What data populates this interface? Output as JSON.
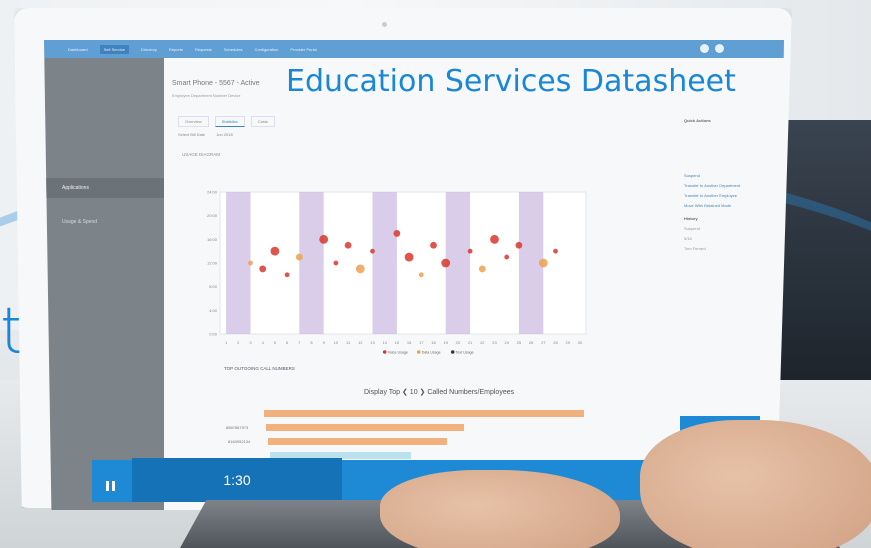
{
  "overlay": {
    "title": "Education Services Datasheet",
    "edge_letter": "t"
  },
  "app": {
    "brand": "",
    "nav": [
      "Dashboard",
      "Self Service",
      "Directory",
      "Reports",
      "Requests",
      "Schedules",
      "Configuration",
      "Provider Portal"
    ],
    "active_nav_index": 1
  },
  "sidebar": {
    "items": [
      "Applications",
      "",
      "Usage & Spend"
    ]
  },
  "page": {
    "title": "Smart Phone - 5567 - Active",
    "subtitle": "Employee  Department  Number  Device",
    "tabs": [
      "Overview",
      "Statistics",
      "Costs"
    ],
    "active_tab_index": 1,
    "selected_billing_label": "Select Bill Date",
    "selected_billing_value": "Jun 2018",
    "display_note": "",
    "usage_section": "USAGE DIAGRAM"
  },
  "right_panel": {
    "header": "Quick Actions",
    "links": [
      "Suspend",
      "Transfer to Another Department",
      "Transfer to Another Employee",
      "Move With Retained Mode"
    ],
    "history_header": "History",
    "history_items": [
      "Suspend",
      "5/18",
      "Tom Ferrard"
    ]
  },
  "chart_data": {
    "type": "scatter",
    "title": "",
    "x_ticks": [
      "1",
      "2",
      "3",
      "4",
      "5",
      "6",
      "7",
      "8",
      "9",
      "10",
      "11",
      "12",
      "13",
      "14",
      "15",
      "16",
      "17",
      "18",
      "19",
      "20",
      "21",
      "22",
      "23",
      "24",
      "25",
      "26",
      "27",
      "28",
      "29",
      "30"
    ],
    "y_ticks": [
      "0:00",
      "4:00",
      "8:00",
      "12:00",
      "16:00",
      "20:00",
      "24:00"
    ],
    "highlighted_days": [
      2,
      8,
      14,
      20,
      26
    ],
    "legend": [
      "Voice Usage",
      "Data Usage",
      "Text Usage"
    ],
    "series_colors": {
      "voice": "#d9362b",
      "data": "#f0a04b",
      "text": "#2b3a4a"
    },
    "points": [
      {
        "x": 3,
        "y": 12
      },
      {
        "x": 4,
        "y": 11
      },
      {
        "x": 5,
        "y": 14
      },
      {
        "x": 6,
        "y": 10
      },
      {
        "x": 7,
        "y": 13
      },
      {
        "x": 9,
        "y": 16
      },
      {
        "x": 10,
        "y": 12
      },
      {
        "x": 11,
        "y": 15
      },
      {
        "x": 12,
        "y": 11
      },
      {
        "x": 13,
        "y": 14
      },
      {
        "x": 15,
        "y": 17
      },
      {
        "x": 16,
        "y": 13
      },
      {
        "x": 17,
        "y": 10
      },
      {
        "x": 18,
        "y": 15
      },
      {
        "x": 19,
        "y": 12
      },
      {
        "x": 21,
        "y": 14
      },
      {
        "x": 22,
        "y": 11
      },
      {
        "x": 23,
        "y": 16
      },
      {
        "x": 24,
        "y": 13
      },
      {
        "x": 25,
        "y": 15
      },
      {
        "x": 27,
        "y": 12
      },
      {
        "x": 28,
        "y": 14
      }
    ]
  },
  "outgoing": {
    "section_title": "TOP OUTGOING CALL NUMBERS",
    "display_top": "Display Top ❮ 10 ❯ Called Numbers/Employees",
    "bars": [
      {
        "label": "",
        "value": 100,
        "tag": ""
      },
      {
        "label": "8887867973",
        "value": 62,
        "tag": ""
      },
      {
        "label": "8163952134",
        "value": 56,
        "tag": ""
      },
      {
        "label": "",
        "value": 44,
        "tag": ""
      }
    ]
  },
  "player": {
    "time": "1:30",
    "icons": [
      "pause-icon",
      "volume-icon",
      "brightness-icon",
      "fullscreen-icon"
    ],
    "accent": "#1e8ad6"
  }
}
